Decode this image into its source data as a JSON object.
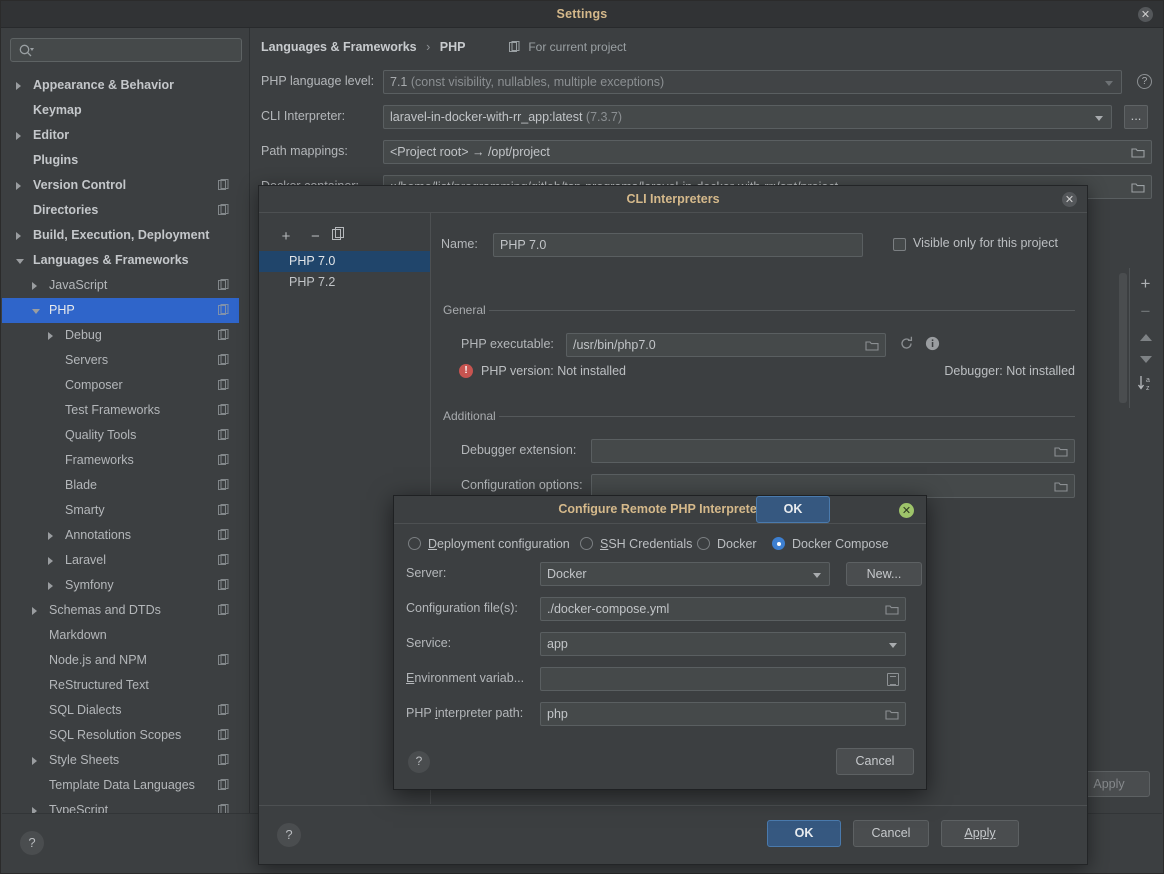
{
  "window": {
    "title": "Settings",
    "close_icon": "close-icon"
  },
  "search": {
    "placeholder": "",
    "value": "",
    "icon": "search-icon"
  },
  "sidebar": {
    "items": [
      {
        "label": "Appearance & Behavior",
        "indent": 0,
        "arrow": "collapsed",
        "bold": true,
        "badge": false
      },
      {
        "label": "Keymap",
        "indent": 0,
        "arrow": "none",
        "bold": true,
        "badge": false
      },
      {
        "label": "Editor",
        "indent": 0,
        "arrow": "collapsed",
        "bold": true,
        "badge": false
      },
      {
        "label": "Plugins",
        "indent": 0,
        "arrow": "none",
        "bold": true,
        "badge": false
      },
      {
        "label": "Version Control",
        "indent": 0,
        "arrow": "collapsed",
        "bold": true,
        "badge": true
      },
      {
        "label": "Directories",
        "indent": 0,
        "arrow": "none",
        "bold": true,
        "badge": true
      },
      {
        "label": "Build, Execution, Deployment",
        "indent": 0,
        "arrow": "collapsed",
        "bold": true,
        "badge": false
      },
      {
        "label": "Languages & Frameworks",
        "indent": 0,
        "arrow": "expanded",
        "bold": true,
        "badge": false
      },
      {
        "label": "JavaScript",
        "indent": 1,
        "arrow": "collapsed",
        "bold": false,
        "badge": true
      },
      {
        "label": "PHP",
        "indent": 1,
        "arrow": "expanded",
        "bold": false,
        "badge": true,
        "selected": true
      },
      {
        "label": "Debug",
        "indent": 2,
        "arrow": "collapsed",
        "bold": false,
        "badge": true
      },
      {
        "label": "Servers",
        "indent": 2,
        "arrow": "none",
        "bold": false,
        "badge": true
      },
      {
        "label": "Composer",
        "indent": 2,
        "arrow": "none",
        "bold": false,
        "badge": true
      },
      {
        "label": "Test Frameworks",
        "indent": 2,
        "arrow": "none",
        "bold": false,
        "badge": true
      },
      {
        "label": "Quality Tools",
        "indent": 2,
        "arrow": "none",
        "bold": false,
        "badge": true
      },
      {
        "label": "Frameworks",
        "indent": 2,
        "arrow": "none",
        "bold": false,
        "badge": true
      },
      {
        "label": "Blade",
        "indent": 2,
        "arrow": "none",
        "bold": false,
        "badge": true
      },
      {
        "label": "Smarty",
        "indent": 2,
        "arrow": "none",
        "bold": false,
        "badge": true
      },
      {
        "label": "Annotations",
        "indent": 2,
        "arrow": "collapsed",
        "bold": false,
        "badge": true
      },
      {
        "label": "Laravel",
        "indent": 2,
        "arrow": "collapsed",
        "bold": false,
        "badge": true
      },
      {
        "label": "Symfony",
        "indent": 2,
        "arrow": "collapsed",
        "bold": false,
        "badge": true
      },
      {
        "label": "Schemas and DTDs",
        "indent": 1,
        "arrow": "collapsed",
        "bold": false,
        "badge": true
      },
      {
        "label": "Markdown",
        "indent": 1,
        "arrow": "none",
        "bold": false,
        "badge": false
      },
      {
        "label": "Node.js and NPM",
        "indent": 1,
        "arrow": "none",
        "bold": false,
        "badge": true
      },
      {
        "label": "ReStructured Text",
        "indent": 1,
        "arrow": "none",
        "bold": false,
        "badge": false
      },
      {
        "label": "SQL Dialects",
        "indent": 1,
        "arrow": "none",
        "bold": false,
        "badge": true
      },
      {
        "label": "SQL Resolution Scopes",
        "indent": 1,
        "arrow": "none",
        "bold": false,
        "badge": true
      },
      {
        "label": "Style Sheets",
        "indent": 1,
        "arrow": "collapsed",
        "bold": false,
        "badge": true
      },
      {
        "label": "Template Data Languages",
        "indent": 1,
        "arrow": "none",
        "bold": false,
        "badge": true
      },
      {
        "label": "TypeScript",
        "indent": 1,
        "arrow": "collapsed",
        "bold": false,
        "badge": true
      }
    ]
  },
  "breadcrumb": {
    "parent": "Languages & Frameworks",
    "separator": "›",
    "current": "PHP",
    "scope_label": "For current project",
    "scope_icon": "project-scope-icon"
  },
  "php_settings": {
    "language_level_label": "PHP language level:",
    "language_level_value": "7.1",
    "language_level_detail": "(const visibility, nullables, multiple exceptions)",
    "cli_interpreter_label": "CLI Interpreter:",
    "cli_interpreter_value": "laravel-in-docker-with-rr_app:latest",
    "cli_interpreter_detail": "(7.3.7)",
    "cli_browse_label": "...",
    "path_mappings_label": "Path mappings:",
    "path_mappings_value": "<Project root> → /opt/project",
    "docker_container_label": "Docker container:",
    "docker_container_value": "::/home/list/programming/gitlab/tsp-programs/laravel-in-docker-with-rr:/opt/project",
    "help_icon": "help-icon"
  },
  "mini_toolbar": {
    "add_icon": "plus-icon",
    "remove_icon": "minus-icon",
    "up_icon": "arrow-up-icon",
    "down_icon": "arrow-down-icon",
    "sort_icon": "sort-az-icon"
  },
  "settings_footer": {
    "help_label": "?",
    "apply_label": "Apply"
  },
  "cli_dialog": {
    "title": "CLI Interpreters",
    "close_icon": "close-icon",
    "toolbar": {
      "add_label": "+",
      "remove_label": "−",
      "copy_label": "copy-icon"
    },
    "interpreters": [
      {
        "label": "PHP 7.0",
        "selected": true
      },
      {
        "label": "PHP 7.2",
        "selected": false
      }
    ],
    "name_label": "Name:",
    "name_value": "PHP 7.0",
    "visible_only_label": "Visible only for this project",
    "visible_only_checked": false,
    "general_section": "General",
    "php_executable_label": "PHP executable:",
    "php_executable_value": "/usr/bin/php7.0",
    "php_version_status": "PHP version: Not installed",
    "debugger_status": "Debugger: Not installed",
    "refresh_icon": "refresh-icon",
    "info_icon": "info-icon",
    "additional_section": "Additional",
    "debugger_extension_label": "Debugger extension:",
    "debugger_extension_value": "",
    "configuration_options_label": "Configuration options:",
    "configuration_options_value": "",
    "help_label": "?",
    "ok_label": "OK",
    "cancel_label": "Cancel",
    "apply_label": "Apply"
  },
  "remote_dialog": {
    "title": "Configure Remote PHP Interpreter",
    "close_icon": "close-icon",
    "options": [
      {
        "label": "Deployment configuration",
        "mnemonic": "D",
        "checked": false
      },
      {
        "label": "SSH Credentials",
        "mnemonic": "S",
        "checked": false
      },
      {
        "label": "Docker",
        "mnemonic": "",
        "checked": false
      },
      {
        "label": "Docker Compose",
        "mnemonic": "",
        "checked": true
      }
    ],
    "server_label": "Server:",
    "server_value": "Docker",
    "new_button_label": "New...",
    "config_files_label": "Configuration file(s):",
    "config_files_value": "./docker-compose.yml",
    "service_label": "Service:",
    "service_value": "app",
    "env_vars_label": "Environment variab...",
    "env_vars_mnemonic": "E",
    "env_vars_value": "",
    "interpreter_path_label": "PHP interpreter path:",
    "interpreter_path_mnemonic": "i",
    "interpreter_path_value": "php",
    "help_label": "?",
    "ok_label": "OK",
    "cancel_label": "Cancel"
  },
  "colors": {
    "accent_blue": "#3d7fd0",
    "selection_blue": "#2f65ca",
    "primary_button": "#365880",
    "title_text": "#d5b98b",
    "error_red": "#c75450",
    "window_bg": "#3c3f41"
  }
}
